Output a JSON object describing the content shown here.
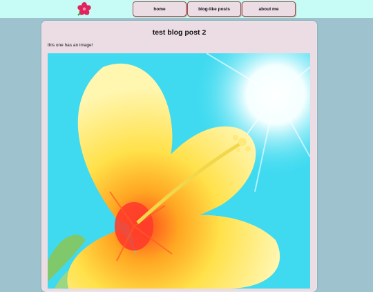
{
  "nav": {
    "logo_icon": "hibiscus-flower-icon",
    "items": [
      {
        "label": "home"
      },
      {
        "label": "blog-like posts"
      },
      {
        "label": "about me"
      }
    ]
  },
  "post": {
    "title": "test blog post 2",
    "text": "this one has an image!",
    "image_subject": "yellow-hibiscus-flower-photo"
  },
  "colors": {
    "page_background": "#9ec3cf",
    "topbar_background": "#c6fcf5",
    "card_background": "#ecdde5",
    "button_border": "#a24a4a",
    "photo_sky": "#3fdaf0",
    "photo_petal": "#ffe24a",
    "photo_center": "#ff3c2a"
  }
}
